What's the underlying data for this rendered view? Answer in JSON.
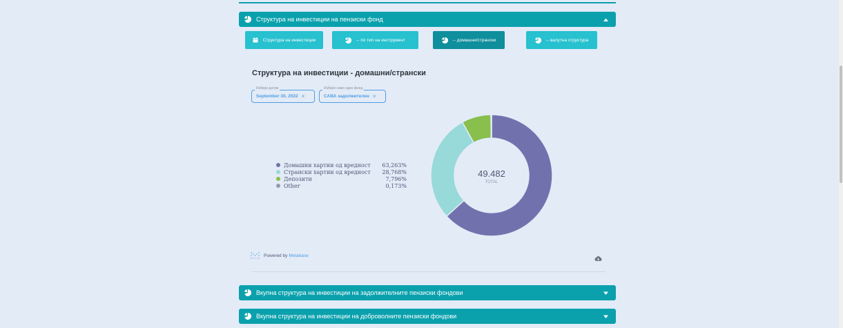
{
  "header": {
    "title": "Структура на инвестиции на пензиски фонд"
  },
  "tabs": [
    {
      "label": "Структура на инвестиции",
      "icon": "calendar-icon"
    },
    {
      "label": "-- по тип на инструмент",
      "icon": "pie-icon"
    },
    {
      "label": "-- домашни/странски",
      "icon": "pie-icon"
    },
    {
      "label": "-- валутна структура",
      "icon": "pie-icon"
    }
  ],
  "active_tab": 2,
  "chart_title": "Структура на инвестиции - домашни/странски",
  "filters": [
    {
      "label": "Избери датум",
      "value": "September 30, 2022"
    },
    {
      "label": "Избери само еден фонд",
      "value": "САВА задолжителен"
    }
  ],
  "chart_data": {
    "type": "pie",
    "title": "Структура на инвестиции - домашни/странски",
    "categories": [
      "Домашни хартии од вредност",
      "Странски хартии од вредност",
      "Депозити",
      "Other"
    ],
    "values": [
      63.263,
      28.768,
      7.796,
      0.173
    ],
    "value_labels": [
      "63,263%",
      "28,768%",
      "7,796%",
      "0,173%"
    ],
    "colors": [
      "#7172ad",
      "#98d9d9",
      "#88bf4d",
      "#949aab"
    ],
    "center_value": "49.482",
    "center_label": "TOTAL",
    "legend_position": "left"
  },
  "footer": {
    "powered_by": "Powered by",
    "brand": "Metabase"
  },
  "sections": [
    {
      "title": "Вкупна структура на инвестиции на задолжителните пензиски фондови"
    },
    {
      "title": "Вкупна структура на инвестиции на доброволните пензиски фондови"
    }
  ]
}
